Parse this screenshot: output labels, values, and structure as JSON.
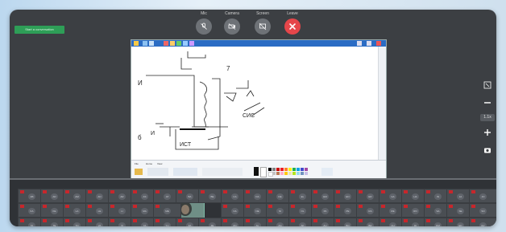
{
  "toolbar": {
    "record_label": "Start a conversation",
    "controls": [
      {
        "label": "Mic",
        "icon": "mic-off-icon",
        "style": "gray"
      },
      {
        "label": "Camera",
        "icon": "camera-off-icon",
        "style": "gray"
      },
      {
        "label": "Screen",
        "icon": "screen-share-off-icon",
        "style": "gray"
      },
      {
        "label": "Leave",
        "icon": "close-icon",
        "style": "red"
      }
    ]
  },
  "screen": {
    "app": "Paint",
    "handwriting": [
      "И",
      "7",
      "б",
      "И",
      "ИСТ",
      "СИС"
    ],
    "ribbon_tabs": [
      "File",
      "Home",
      "View"
    ]
  },
  "zoom": {
    "level": "1.1x"
  },
  "participants": {
    "row1": [
      "AB",
      "AD",
      "AM",
      "AN",
      "AR",
      "AS",
      "AT",
      "BA",
      "BE",
      "CA",
      "DA",
      "DE",
      "EL",
      "EM",
      "EN",
      "ER",
      "GA",
      "HA",
      "IN",
      "JA",
      "JO"
    ],
    "row2": [
      "KA",
      "KE",
      "LA",
      "LE",
      "LI",
      "MA",
      "ME",
      "MI",
      "MO",
      "NA",
      "NE",
      "NI",
      "OL",
      "PA",
      "PE",
      "RA",
      "RE",
      "RO",
      "SA",
      "SE",
      "SO"
    ],
    "row3": [
      "TA",
      "TE",
      "TO",
      "VA",
      "VI",
      "YA",
      "YU",
      "ZA",
      "ZE",
      "ZO",
      "AL",
      "AG",
      "AK",
      "AU",
      "BO",
      "BR",
      "CH",
      "DI",
      "DM",
      "ED",
      "EV"
    ]
  },
  "colors": {
    "accent_green": "#2e9e57",
    "leave_red": "#e5464a",
    "badge_red": "#c8262b",
    "panel_bg": "#3c3f43"
  }
}
